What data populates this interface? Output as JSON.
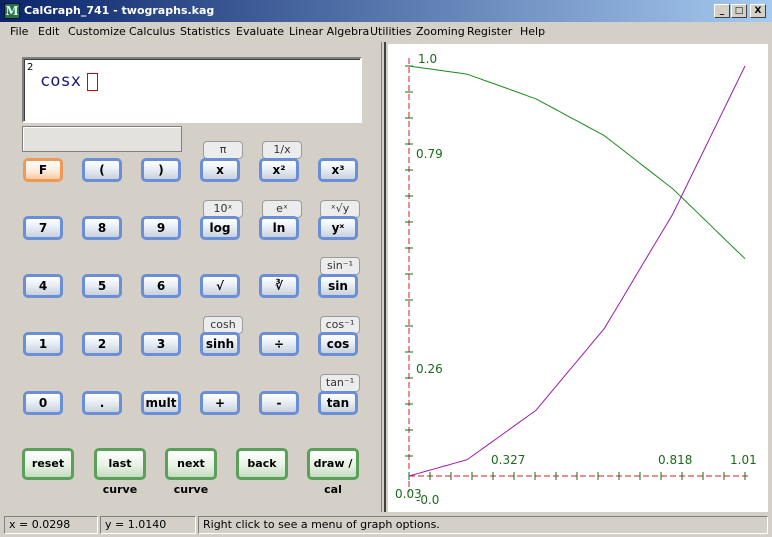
{
  "window": {
    "title": "CalGraph_741 - twographs.kag",
    "app_icon": "M",
    "buttons": [
      "_",
      "□",
      "X"
    ]
  },
  "menu": [
    "File",
    "Edit",
    "Customize",
    "Calculus",
    "Statistics",
    "Evaluate",
    "Linear Algebra",
    "Utilities",
    "Zooming",
    "Register",
    "Help"
  ],
  "display": {
    "exponent": "2",
    "expression": "cosx"
  },
  "keys": {
    "F": "F",
    "lparen": "(",
    "rparen": ")",
    "x": "x",
    "x2": "x²",
    "x3": "x³",
    "k7": "7",
    "k8": "8",
    "k9": "9",
    "log": "log",
    "ln": "ln",
    "yx": "yˣ",
    "k4": "4",
    "k5": "5",
    "k6": "6",
    "sqrt": "√",
    "cbrt": "∛",
    "sin": "sin",
    "k1": "1",
    "k2": "2",
    "k3": "3",
    "sinh": "sinh",
    "div": "÷",
    "cos": "cos",
    "k0": "0",
    "dot": ".",
    "mult": "mult",
    "plus": "+",
    "minus": "-",
    "tan": "tan"
  },
  "secondary": {
    "pi": "π",
    "inv": "1/x",
    "tenx": "10ˣ",
    "ex": "eˣ",
    "xrooty": "ˣ√y",
    "asin": "sin⁻¹",
    "cosh": "cosh",
    "acos": "cos⁻¹",
    "atan": "tan⁻¹"
  },
  "actions": {
    "reset": "reset",
    "last_curve": "last curve",
    "next_curve": "next curve",
    "back": "back",
    "draw_cal": "draw / cal"
  },
  "graph": {
    "y_ticks": [
      "1.0",
      "0.79",
      "0.26",
      "-0.0"
    ],
    "x_ticks": [
      "0.03",
      "0.327",
      "0.818",
      "1.01"
    ],
    "colors": {
      "axis": "#cc2222",
      "curve1": "#1a8a1a",
      "curve2": "#9a1aa8",
      "ticks": "#1a6a1a"
    }
  },
  "chart_data": {
    "type": "line",
    "xlim": [
      0.03,
      1.01
    ],
    "ylim": [
      0.0,
      1.0
    ],
    "series": [
      {
        "x": [
          0.03,
          0.2,
          0.4,
          0.6,
          0.8,
          1.01
        ],
        "y": [
          1.0,
          0.98,
          0.92,
          0.83,
          0.7,
          0.53
        ]
      },
      {
        "x": [
          0.03,
          0.2,
          0.4,
          0.6,
          0.8,
          1.01
        ],
        "y": [
          0.0,
          0.04,
          0.16,
          0.36,
          0.64,
          1.0
        ]
      }
    ]
  },
  "status": {
    "x": "x = 0.0298",
    "y": "y = 1.0140",
    "message": "Right click to see a menu of graph options."
  }
}
